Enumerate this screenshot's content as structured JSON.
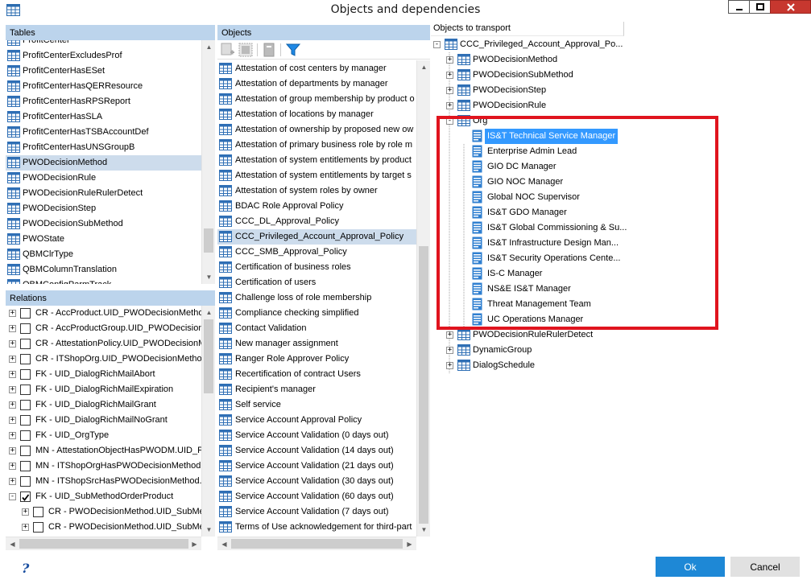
{
  "window": {
    "title": "Objects and dependencies"
  },
  "tables": {
    "header": "Tables",
    "items": [
      "ProfitCenter",
      "ProfitCenterExcludesProf",
      "ProfitCenterHasESet",
      "ProfitCenterHasQERResource",
      "ProfitCenterHasRPSReport",
      "ProfitCenterHasSLA",
      "ProfitCenterHasTSBAccountDef",
      "ProfitCenterHasUNSGroupB",
      "PWODecisionMethod",
      "PWODecisionRule",
      "PWODecisionRuleRulerDetect",
      "PWODecisionStep",
      "PWODecisionSubMethod",
      "PWOState",
      "QBMClrType",
      "QBMColumnTranslation",
      "QBMConfigParmTrack"
    ],
    "selected_index": 8
  },
  "relations": {
    "header": "Relations",
    "items": [
      {
        "label": "CR - AccProduct.UID_PWODecisionMethod",
        "checked": false
      },
      {
        "label": "CR - AccProductGroup.UID_PWODecisionM",
        "checked": false
      },
      {
        "label": "CR - AttestationPolicy.UID_PWODecisionM",
        "checked": false
      },
      {
        "label": "CR - ITShopOrg.UID_PWODecisionMethod",
        "checked": false
      },
      {
        "label": "FK - UID_DialogRichMailAbort",
        "checked": false
      },
      {
        "label": "FK - UID_DialogRichMailExpiration",
        "checked": false
      },
      {
        "label": "FK - UID_DialogRichMailGrant",
        "checked": false
      },
      {
        "label": "FK - UID_DialogRichMailNoGrant",
        "checked": false
      },
      {
        "label": "FK - UID_OrgType",
        "checked": false
      },
      {
        "label": "MN - AttestationObjectHasPWODM.UID_P",
        "checked": false
      },
      {
        "label": "MN - ITShopOrgHasPWODecisionMethod.UI",
        "checked": false
      },
      {
        "label": "MN - ITShopSrcHasPWODecisionMethod.UI",
        "checked": false
      },
      {
        "label": "FK - UID_SubMethodOrderProduct",
        "checked": true
      },
      {
        "label": "CR - PWODecisionMethod.UID_SubMet",
        "checked": false
      },
      {
        "label": "CR - PWODecisionMethod.UID_SubMet",
        "checked": false
      }
    ]
  },
  "objects": {
    "header": "Objects",
    "items": [
      "Attestation of cost centers by manager",
      "Attestation of departments by manager",
      "Attestation of group membership by product o",
      "Attestation of locations by manager",
      "Attestation of ownership by proposed new ow",
      "Attestation of primary business role by role m",
      "Attestation of system entitlements by product",
      "Attestation of system entitlements by target s",
      "Attestation of system roles by owner",
      "BDAC Role Approval Policy",
      "CCC_DL_Approval_Policy",
      "CCC_Privileged_Account_Approval_Policy",
      "CCC_SMB_Approval_Policy",
      "Certification of business roles",
      "Certification of users",
      "Challenge loss of role membership",
      "Compliance checking simplified",
      "Contact Validation",
      "New manager assignment",
      "Ranger Role Approver Policy",
      "Recertification of contract Users",
      "Recipient's manager",
      "Self service",
      "Service Account Approval Policy",
      "Service Account Validation (0 days out)",
      "Service Account Validation (14 days out)",
      "Service Account Validation (21 days out)",
      "Service Account Validation (30 days out)",
      "Service Account Validation (60 days out)",
      "Service Account Validation (7 days out)",
      "Terms of Use acknowledgement for third-part"
    ],
    "selected_index": 11
  },
  "transport": {
    "header": "Objects to transport",
    "root": "CCC_Privileged_Account_Approval_Po...",
    "children": [
      "PWODecisionMethod",
      "PWODecisionSubMethod",
      "PWODecisionStep",
      "PWODecisionRule"
    ],
    "org_label": "Org",
    "org_items": [
      "IS&T Technical Service Manager",
      "Enterprise Admin Lead",
      "GIO DC Manager",
      "GIO NOC Manager",
      "Global NOC Supervisor",
      "IS&T GDO Manager",
      "IS&T Global Commissioning & Su...",
      "IS&T Infrastructure Design Man...",
      "IS&T Security Operations Cente...",
      "IS-C Manager",
      "NS&E IS&T Manager",
      "Threat Management Team",
      "UC Operations Manager"
    ],
    "after": [
      "PWODecisionRuleRulerDetect",
      "DynamicGroup",
      "DialogSchedule"
    ],
    "highlight_color": "#e0141e",
    "selection_color": "#3399ff"
  },
  "footer": {
    "help_icon": "?",
    "ok_label": "Ok",
    "cancel_label": "Cancel"
  }
}
